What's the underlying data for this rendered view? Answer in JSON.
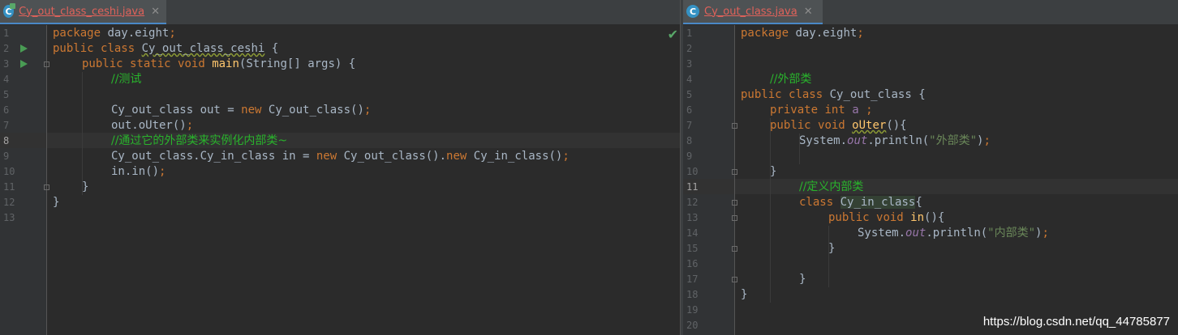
{
  "left_editor": {
    "tab_icon": "java-class-icon",
    "tab_label": "Cy_out_class_ceshi.java",
    "close_glyph": "✕",
    "line_numbers": [
      "1",
      "2",
      "3",
      "4",
      "5",
      "6",
      "7",
      "8",
      "9",
      "10",
      "11",
      "12",
      "13"
    ],
    "highlighted_line": "8",
    "status_glyph": "✔"
  },
  "right_editor": {
    "tab_icon": "java-class-icon",
    "tab_label": "Cy_out_class.java",
    "close_glyph": "✕",
    "line_numbers": [
      "1",
      "2",
      "3",
      "4",
      "5",
      "6",
      "7",
      "8",
      "9",
      "10",
      "11",
      "12",
      "13",
      "14",
      "15",
      "16",
      "17",
      "18",
      "19",
      "20"
    ],
    "highlighted_line": "11"
  },
  "code": {
    "kw_package": "package",
    "kw_public": "public",
    "kw_class": "class",
    "kw_static": "static",
    "kw_void": "void",
    "kw_new": "new",
    "kw_private": "private",
    "kw_int": "int",
    "pkg": "day.eight",
    "cls_ceshi": "Cy_out_class_ceshi",
    "cls_out": "Cy_out_class",
    "cls_in": "Cy_in_class",
    "m_main": "main",
    "main_args": "(String[] args) {",
    "cm_test": "//测试",
    "l6_a": "Cy_out_class out = ",
    "l6_b": "Cy_out_class()",
    "l7": "out.oUter()",
    "cm_via": "//通过它的外部类来实例化内部类~",
    "l9_a": "Cy_out_class.Cy_in_class in = ",
    "l9_b": "Cy_out_class().",
    "l9_c": "Cy_in_class()",
    "l10": "in.in()",
    "cm_outer": "//外部类",
    "fld_a": "a",
    "m_outer": "oUter",
    "sys": "System.",
    "out_field": "out",
    "println": ".println(",
    "str_outer": "\"外部类\"",
    "cm_define_inner": "//定义内部类",
    "m_in": "in",
    "str_inner": "\"内部类\""
  },
  "watermark": "https://blog.csdn.net/qq_44785877",
  "colors": {
    "background": "#2b2b2b",
    "keyword": "#cc7832",
    "method": "#ffc66d",
    "string": "#6a8759",
    "comment": "#29b32c",
    "field": "#9876aa",
    "tab_label": "#e0625a"
  }
}
